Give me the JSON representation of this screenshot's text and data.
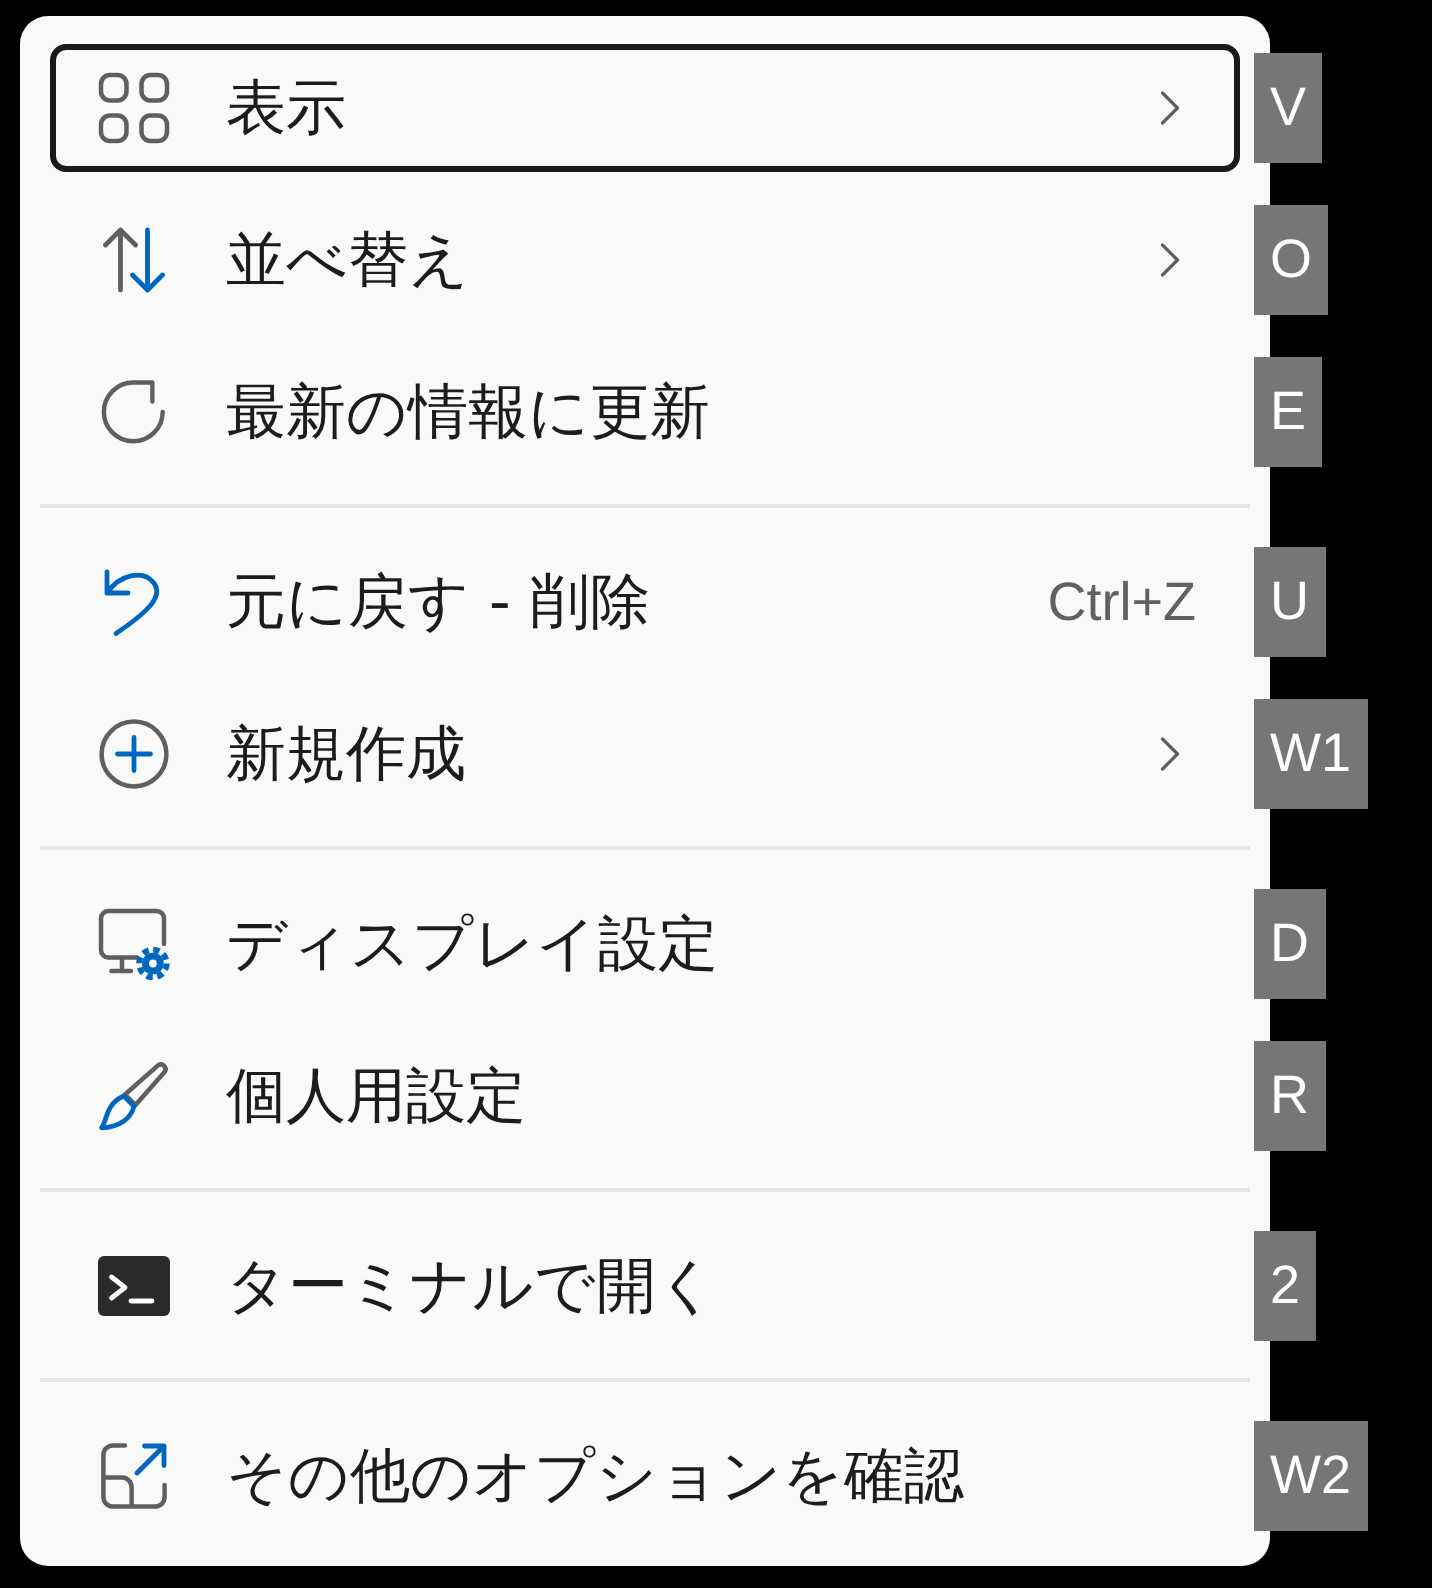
{
  "context_menu": {
    "groups": [
      {
        "items": [
          {
            "label": "表示",
            "selected": true,
            "submenu": true,
            "access_key": "V"
          },
          {
            "label": "並べ替え",
            "selected": false,
            "submenu": true,
            "access_key": "O"
          },
          {
            "label": "最新の情報に更新",
            "selected": false,
            "submenu": false,
            "access_key": "E"
          }
        ]
      },
      {
        "items": [
          {
            "label": "元に戻す - 削除",
            "shortcut": "Ctrl+Z",
            "selected": false,
            "submenu": false,
            "access_key": "U"
          },
          {
            "label": "新規作成",
            "selected": false,
            "submenu": true,
            "access_key": "W1"
          }
        ]
      },
      {
        "items": [
          {
            "label": "ディスプレイ設定",
            "selected": false,
            "submenu": false,
            "access_key": "D"
          },
          {
            "label": "個人用設定",
            "selected": false,
            "submenu": false,
            "access_key": "R"
          }
        ]
      },
      {
        "items": [
          {
            "label": "ターミナルで開く",
            "selected": false,
            "submenu": false,
            "access_key": "2"
          }
        ]
      },
      {
        "items": [
          {
            "label": "その他のオプションを確認",
            "selected": false,
            "submenu": false,
            "access_key": "W2"
          }
        ]
      }
    ]
  }
}
